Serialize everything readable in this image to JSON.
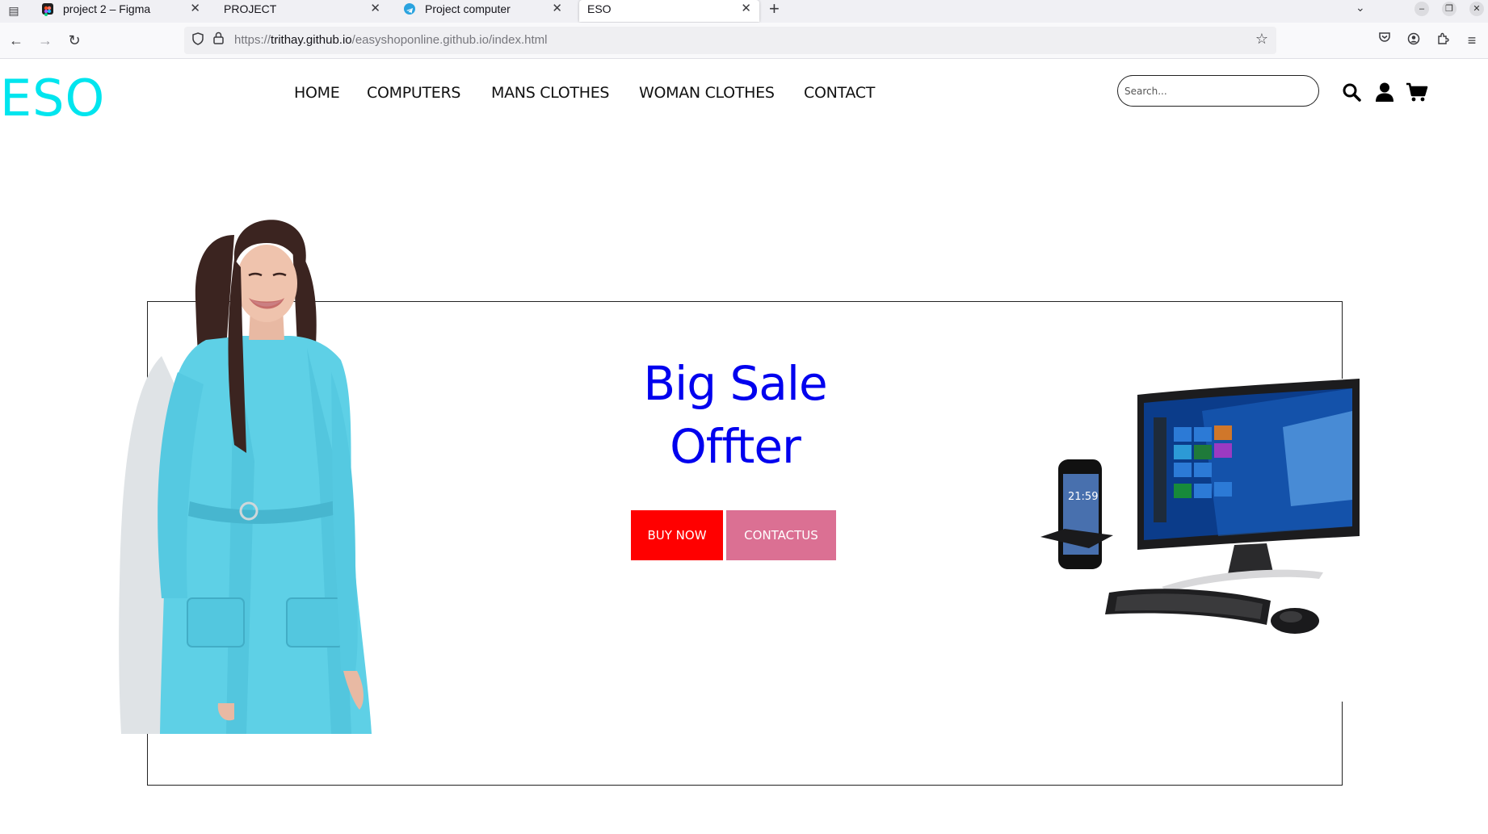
{
  "browser": {
    "tabs": [
      {
        "title": "project 2 – Figma",
        "favicon": "figma-icon"
      },
      {
        "title": "PROJECT",
        "favicon": ""
      },
      {
        "title": "Project computer",
        "favicon": "telegram-icon"
      },
      {
        "title": "ESO",
        "favicon": "",
        "active": true
      }
    ],
    "url_prefix": "https://",
    "url_domain": "trithay.github.io",
    "url_path": "/easyshoponline.github.io/index.html"
  },
  "site": {
    "logo": "ESO",
    "nav": [
      "HOME",
      "COMPUTERS",
      "MANS CLOTHES",
      "WOMAN CLOTHES",
      "CONTACT"
    ],
    "search_placeholder": "Search...",
    "icons": [
      "search-icon",
      "user-icon",
      "cart-icon"
    ]
  },
  "hero": {
    "title_line1": "Big Sale",
    "title_line2": "Offter",
    "buy_label": "BUY NOW",
    "contact_label": "CONTACTUS"
  },
  "colors": {
    "logo": "#00e5ee",
    "title": "#0000ee",
    "buy_button": "#ff0000",
    "contact_button": "#db7093",
    "dress": "#5ed0e6"
  }
}
